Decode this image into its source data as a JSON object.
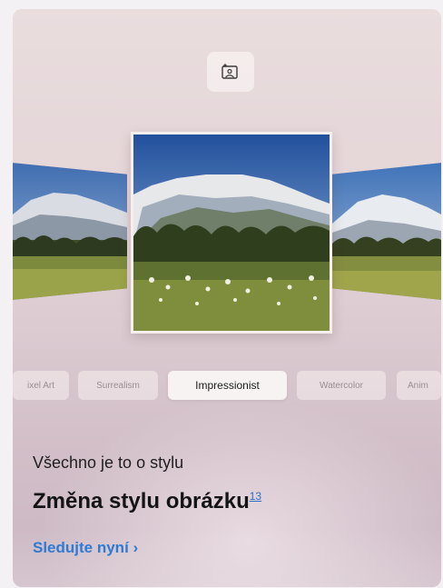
{
  "card": {
    "subtitle": "Všechno je to o stylu",
    "title": "Změna stylu obrázku",
    "footnote": "13",
    "cta_label": "Sledujte nyní",
    "cta_chevron": "›"
  },
  "icons": {
    "top": "image-frame-sparkle-icon"
  },
  "styles": [
    {
      "label": "ixel Art",
      "active": false
    },
    {
      "label": "Surrealism",
      "active": false
    },
    {
      "label": "Impressionist",
      "active": true
    },
    {
      "label": "Watercolor",
      "active": false
    },
    {
      "label": "Anim",
      "active": false
    }
  ],
  "colors": {
    "accent": "#2f7ad3",
    "title": "#141414",
    "pill_active": "#f7f3f3"
  }
}
